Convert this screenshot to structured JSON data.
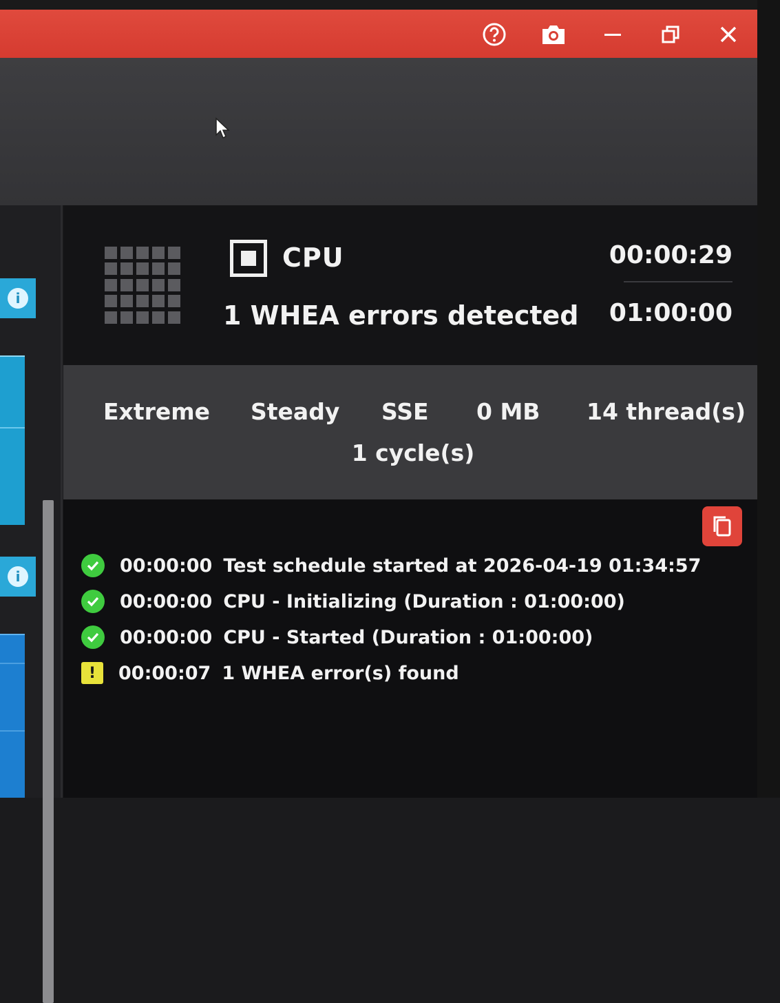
{
  "titlebar": {
    "accent": "#d94236",
    "icons": [
      "help-icon",
      "camera-icon",
      "minimize-icon",
      "restore-icon",
      "close-icon"
    ]
  },
  "cpu": {
    "label": "CPU",
    "message": "1 WHEA errors detected",
    "elapsed": "00:00:29",
    "duration": "01:00:00"
  },
  "settings": {
    "mode": "Extreme",
    "profile": "Steady",
    "instruction": "SSE",
    "memory": "0 MB",
    "threads": "14 thread(s)",
    "cycles": "1 cycle(s)"
  },
  "log": [
    {
      "status": "ok",
      "time": "00:00:00",
      "text": "Test schedule started at 2026-04-19 01:34:57"
    },
    {
      "status": "ok",
      "time": "00:00:00",
      "text": "CPU - Initializing (Duration : 01:00:00)"
    },
    {
      "status": "ok",
      "time": "00:00:00",
      "text": "CPU - Started (Duration : 01:00:00)"
    },
    {
      "status": "warn",
      "time": "00:00:07",
      "text": "1 WHEA error(s) found"
    }
  ],
  "colors": {
    "ok": "#3fcb3f",
    "warn": "#e8e23a",
    "info": "#2aa8d8"
  }
}
